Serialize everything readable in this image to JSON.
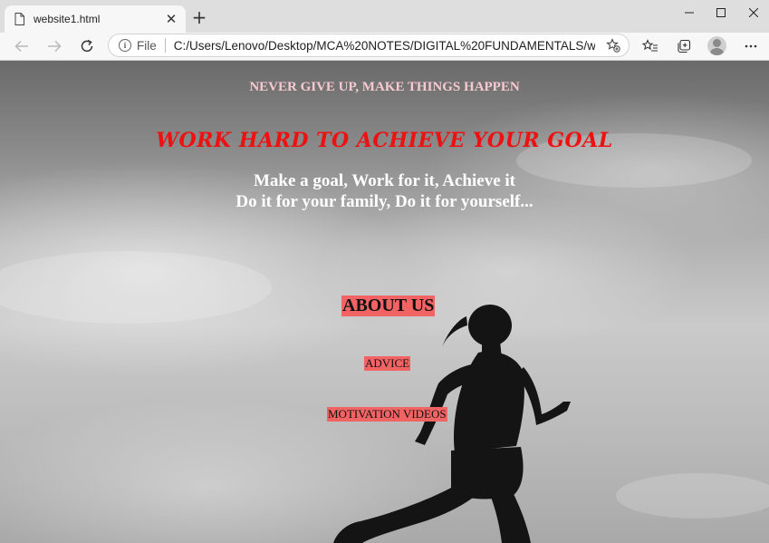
{
  "browser": {
    "tab": {
      "title": "website1.html"
    },
    "address": {
      "scheme_label": "File",
      "url": "C:/Users/Lenovo/Desktop/MCA%20NOTES/DIGITAL%20FUNDAMENTALS/webs..."
    },
    "icons": {
      "page": "document-icon",
      "close": "close-icon",
      "new_tab": "plus-icon",
      "back": "back-arrow-icon",
      "forward": "forward-arrow-icon",
      "refresh": "refresh-icon",
      "info": "info-icon",
      "add_favorite": "add-favorite-icon",
      "favorites": "favorites-icon",
      "collections": "collections-icon",
      "profile": "profile-avatar",
      "more": "more-icon"
    }
  },
  "page": {
    "tagline": "NEVER GIVE UP, MAKE THINGS HAPPEN",
    "headline": "WORK HARD TO ACHIEVE YOUR GOAL",
    "line1": "Make a goal, Work for it, Achieve it",
    "line2": "Do it for your family, Do it for yourself...",
    "links": {
      "about": "ABOUT US",
      "advice": "ADVICE",
      "videos": "MOTIVATION VIDEOS"
    },
    "colors": {
      "tagline": "#f7c9d2",
      "headline": "#ee1111",
      "link_bg": "#f26363"
    }
  }
}
